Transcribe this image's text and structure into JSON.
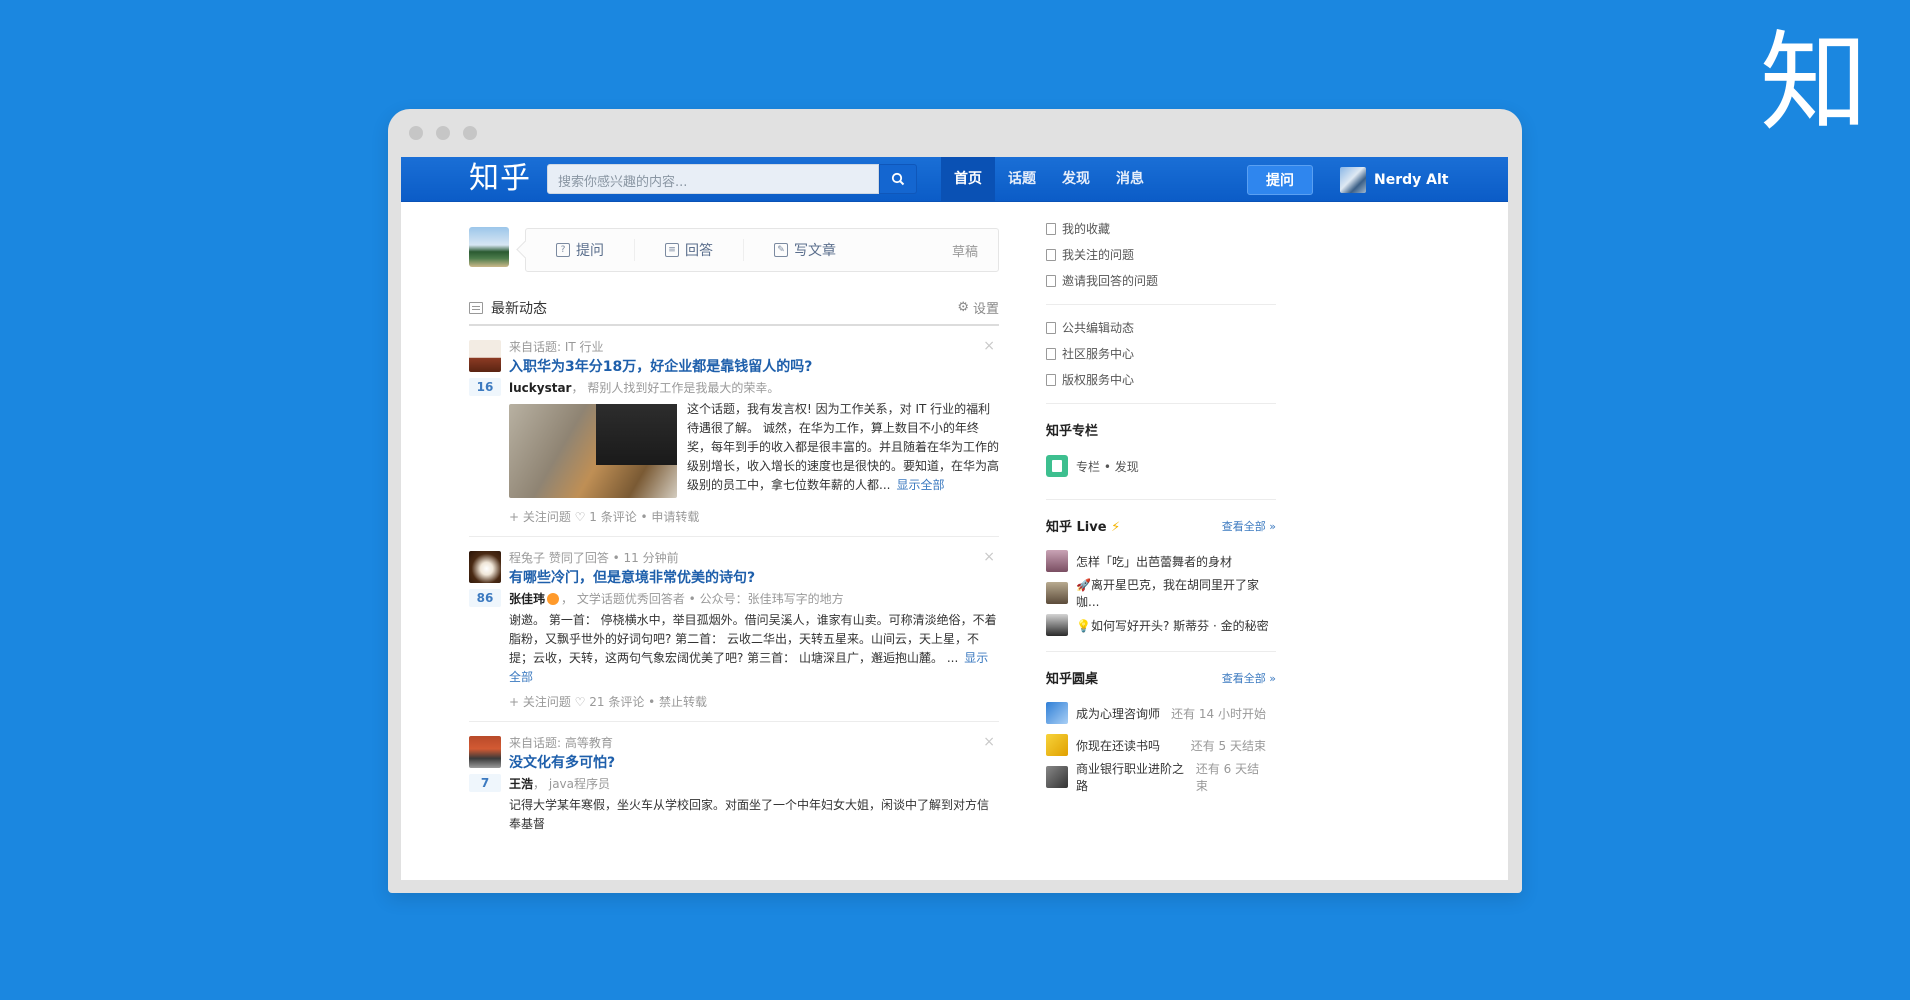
{
  "corner_logo": "知",
  "topbar": {
    "brand": "知乎",
    "search_placeholder": "搜索你感兴趣的内容...",
    "nav": [
      "首页",
      "话题",
      "发现",
      "消息"
    ],
    "ask_label": "提问",
    "user_name": "Nerdy Alt"
  },
  "composer": {
    "actions": [
      "提问",
      "回答",
      "写文章"
    ],
    "draft": "草稿"
  },
  "feed": {
    "title": "最新动态",
    "settings": "设置",
    "items": [
      {
        "meta": "来自话题: IT 行业",
        "title": "入职华为3年分18万，好企业都是靠钱留人的吗?",
        "votes": "16",
        "author": "luckystar",
        "author_sep": "，",
        "bio": "帮别人找到好工作是我最大的荣幸。",
        "excerpt": "这个话题，我有发言权! 因为工作关系，对 IT 行业的福利待遇很了解。 诚然，在华为工作，算上数目不小的年终奖，每年到手的收入都是很丰富的。并且随着在华为工作的级别增长，收入增长的速度也是很快的。要知道，在华为高级别的员工中，拿七位数年薪的人都...",
        "more": "显示全部",
        "actions": "+ 关注问题  ♡ 1 条评论 • 申请转载"
      },
      {
        "meta": "程兔子 赞同了回答 • 11 分钟前",
        "title": "有哪些冷门，但是意境非常优美的诗句?",
        "votes": "86",
        "author": "张佳玮",
        "author_sep": "，",
        "bio": "文学话题优秀回答者 • 公众号：",
        "bio_link": "张佳玮写字的地方",
        "excerpt": "谢邀。 第一首： 停桡横水中，举目孤烟外。借问吴溪人，谁家有山卖。可称清淡绝俗，不着脂粉，又飘乎世外的好词句吧? 第二首： 云收二华出，天转五星来。山间云，天上星，不提；云收，天转，这两句气象宏阔优美了吧? 第三首： 山塘深且广，邂逅抱山麓。 ...",
        "more": "显示全部",
        "actions": "+ 关注问题  ♡ 21 条评论 • 禁止转载"
      },
      {
        "meta": "来自话题: 高等教育",
        "title": "没文化有多可怕?",
        "votes": "7",
        "author": "王浩",
        "author_sep": "，",
        "bio": "java程序员",
        "excerpt": "记得大学某年寒假，坐火车从学校回家。对面坐了一个中年妇女大姐，闲谈中了解到对方信奉基督"
      }
    ]
  },
  "sidebar": {
    "links1": [
      "我的收藏",
      "我关注的问题",
      "邀请我回答的问题"
    ],
    "links2": [
      "公共编辑动态",
      "社区服务中心",
      "版权服务中心"
    ],
    "column_title": "知乎专栏",
    "column_link": "专栏 • 发现",
    "live_title": "知乎 Live",
    "live_all": "查看全部 »",
    "lives": [
      "怎样「吃」出芭蕾舞者的身材",
      "🚀离开星巴克，我在胡同里开了家咖...",
      "💡如何写好开头? 斯蒂芬 · 金的秘密"
    ],
    "round_title": "知乎圆桌",
    "round_all": "查看全部 »",
    "rounds": [
      {
        "name": "成为心理咨询师",
        "status": "还有 14 小时开始"
      },
      {
        "name": "你现在还读书吗",
        "status": "还有 5 天结束"
      },
      {
        "name": "商业银行职业进阶之路",
        "status": "还有 6 天结束"
      }
    ]
  }
}
